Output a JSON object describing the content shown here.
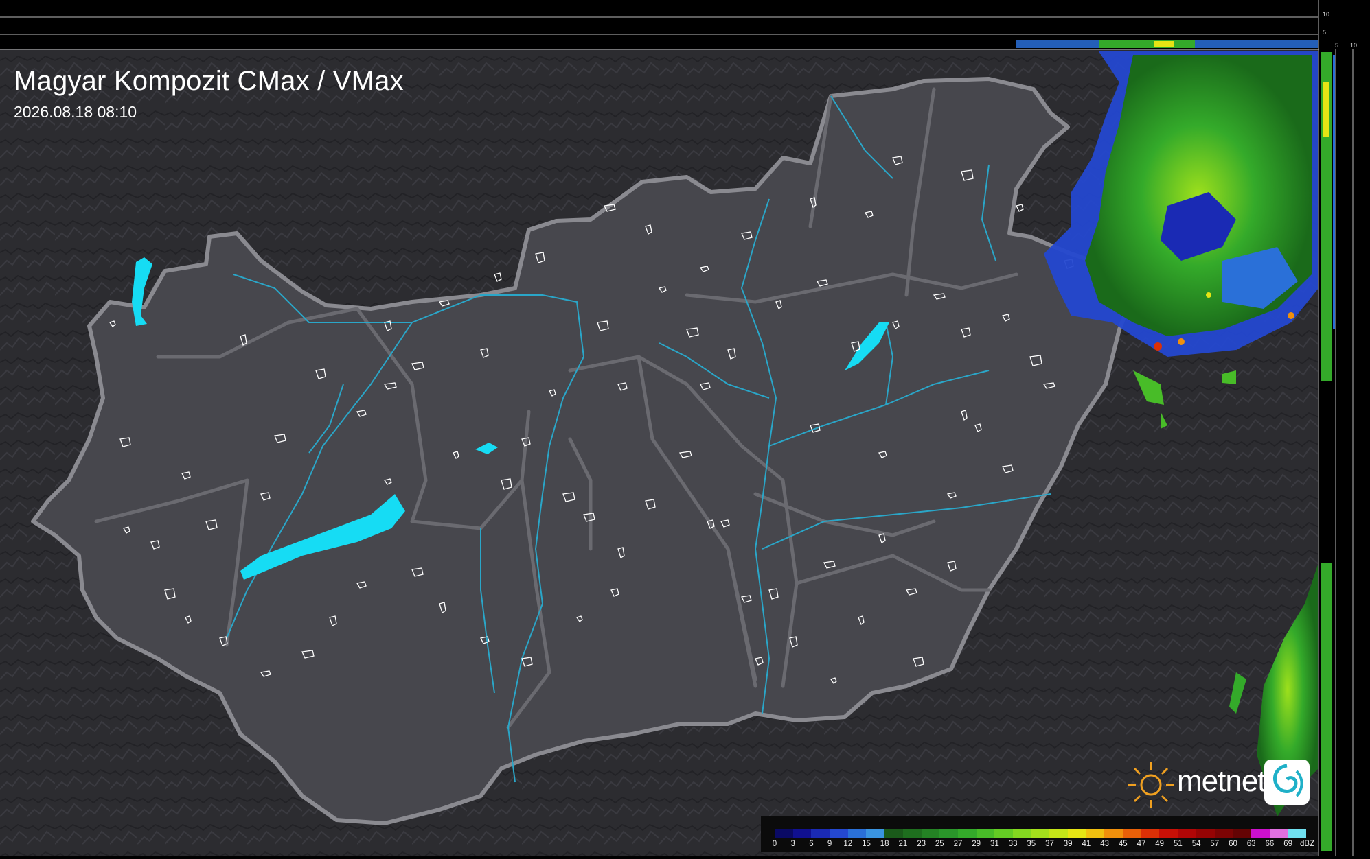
{
  "header": {
    "title": "Magyar Kompozit CMax / VMax",
    "timestamp": "2026.08.18 08:10"
  },
  "side_scale": {
    "top_ticks": [
      "10",
      "5"
    ],
    "right_ticks": [
      "5",
      "10"
    ]
  },
  "legend": {
    "unit": "dBZ",
    "labels": [
      "0",
      "3",
      "6",
      "9",
      "12",
      "15",
      "18",
      "21",
      "23",
      "25",
      "27",
      "29",
      "31",
      "33",
      "35",
      "37",
      "39",
      "41",
      "43",
      "45",
      "47",
      "49",
      "51",
      "54",
      "57",
      "60",
      "63",
      "66",
      "69"
    ],
    "colors": [
      "#0a0a64",
      "#101090",
      "#1a2ab4",
      "#2448d0",
      "#2a70d8",
      "#3a94e0",
      "#1a5a1a",
      "#1e6e1e",
      "#248224",
      "#2a962a",
      "#34aa2a",
      "#48bc28",
      "#64cc24",
      "#84d820",
      "#a4e01c",
      "#c4e418",
      "#e6e414",
      "#f0c010",
      "#f0900c",
      "#e86008",
      "#dc3006",
      "#c81006",
      "#b00606",
      "#960404",
      "#7c0404",
      "#640404",
      "#cc10cc",
      "#e070e0",
      "#70e0f0"
    ]
  },
  "brand": {
    "name": "metnet"
  },
  "map": {
    "background_color": "#2b2b2f",
    "country_fill": "#47474d",
    "border_color": "#8a8a90",
    "water_color": "#16dcf4",
    "river_color": "#2aa6c8"
  }
}
